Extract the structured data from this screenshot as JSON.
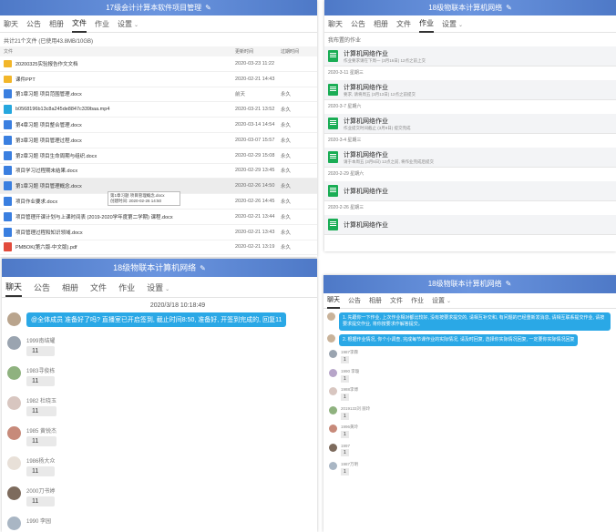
{
  "files_panel": {
    "title": "17级会计计算本软件项目管理",
    "tabs": [
      "聊天",
      "公告",
      "相册",
      "文件",
      "作业",
      "设置"
    ],
    "active_tab": "文件",
    "summary": "共计21个文件 (已使用43.8MB/10GB)",
    "columns": [
      "文件",
      "更新时间",
      "过期时间"
    ],
    "files": [
      {
        "name": "20200325实验报告作文文档",
        "time": "2020-03-23 11:22",
        "expire": "",
        "type": "folder"
      },
      {
        "name": "课件PPT",
        "time": "2020-02-21 14:43",
        "expire": "",
        "type": "folder"
      },
      {
        "name": "第1章习题 项目范围管理.docx",
        "time": "前天",
        "expire": "永久",
        "type": "word"
      },
      {
        "name": "b0568196b13c8a245de8847c339baa.mp4",
        "time": "2020-03-21 13:52",
        "expire": "永久",
        "type": "video"
      },
      {
        "name": "第4章习题 项目整合管理.docx",
        "time": "2020-03-14 14:54",
        "expire": "永久",
        "type": "word"
      },
      {
        "name": "第3章习题 项目管理过程.docx",
        "time": "2020-03-07 15:57",
        "expire": "永久",
        "type": "word"
      },
      {
        "name": "第2章习题 项目生命周期与组织.docx",
        "time": "2020-02-29 15:08",
        "expire": "永久",
        "type": "word"
      },
      {
        "name": "项目学习过程期末结果.docx",
        "time": "2020-02-29 13:45",
        "expire": "永久",
        "type": "word"
      },
      {
        "name": "第1章习题 项目管理概念.docx",
        "time": "2020-02-26 14:50",
        "expire": "永久",
        "type": "word"
      },
      {
        "name": "项目作业要求.docx",
        "time": "2020-02-26 14:45",
        "expire": "永久",
        "type": "word"
      },
      {
        "name": "项目管理开课计划与上课时间表 (2019-2020学年度第二学期) 课程.docx",
        "time": "2020-02-21 13:44",
        "expire": "永久",
        "type": "word"
      },
      {
        "name": "项目管理过程和知识领域.docx",
        "time": "2020-02-21 13:43",
        "expire": "永久",
        "type": "word"
      },
      {
        "name": "PMBOK(第六版-中文版).pdf",
        "time": "2020-02-21 13:19",
        "expire": "永久",
        "type": "pdf"
      }
    ],
    "tooltip": [
      "第1章习题 项目管理概念.docx",
      "创建时间: 2020-02-26 14:50"
    ]
  },
  "homework_panel": {
    "title": "18级物联本计算机网络",
    "tabs": [
      "聊天",
      "公告",
      "相册",
      "文件",
      "作业",
      "设置"
    ],
    "active_tab": "作业",
    "label": "我布置的作业",
    "items": [
      {
        "title": "计算机网络作业",
        "desc": "作业要求请在下周一 (3月16日) 12点之前上交",
        "date": "2020-3-11 星期三"
      },
      {
        "title": "计算机网络作业",
        "desc": "要求, 请将周五 (3月13日) 12点之前提交",
        "date": "2020-3-7 星期六"
      },
      {
        "title": "计算机网络作业",
        "desc": "作业提交时间截止 (3月9日) 提交完成",
        "date": "2020-3-4 星期三"
      },
      {
        "title": "计算机网络作业",
        "desc": "请于本周五 (3月6日) 12点之前, 将作业完成后提交",
        "date": "2020-2-29 星期六"
      },
      {
        "title": "计算机网络作业",
        "desc": "",
        "date": "2020-2-26 星期三"
      },
      {
        "title": "计算机网络作业",
        "desc": "",
        "date": ""
      }
    ]
  },
  "chat_panel_left": {
    "title": "18级物联本计算机网络",
    "tabs": [
      "聊天",
      "公告",
      "相册",
      "文件",
      "作业",
      "设置"
    ],
    "active_tab": "聊天",
    "timestamp": "2020/3/18 10:18:49",
    "announcement": "@全体成员 准备好了吗? 直播室已开启签到, 截止时间8:50, 准备好, 开签到完成的, 回复11",
    "messages": [
      {
        "sender": "1999南结耀",
        "text": "11"
      },
      {
        "sender": "1983寻俊栋",
        "text": "11"
      },
      {
        "sender": "1982 杜晓玉",
        "text": "11"
      },
      {
        "sender": "1985 黄锐杰",
        "text": "11"
      },
      {
        "sender": "1986杨大众",
        "text": "11"
      },
      {
        "sender": "2000刀书婷",
        "text": "11"
      },
      {
        "sender": "1990 李园",
        "text": ""
      }
    ]
  },
  "chat_panel_right": {
    "title": "18级物联本计算机网络",
    "tabs": [
      "聊天",
      "公告",
      "相册",
      "文件",
      "作业",
      "设置"
    ],
    "active_tab": "聊天",
    "notices": [
      "1. 先跟你一下作业, 上次作业相对都比较好, 没有按要求提交的, 请相互补交和, 有问题的已经重新发消息, 请相互联系提交作业, 请按要求提交作业, 将你按要求作解答提交。",
      "2. 根据作业情况, 你个小调查, 完成每节课作业的实际情况, 请及时回复, 选择你实际情况回复, 一定要你实际情况回复"
    ],
    "messages": [
      {
        "sender": "1987李霖",
        "text": "1"
      },
      {
        "sender": "1990 李璇",
        "text": "1"
      },
      {
        "sender": "1988李博",
        "text": "1"
      },
      {
        "sender": "2019133刘 丽玲",
        "text": "1"
      },
      {
        "sender": "1996黄玲",
        "text": "1"
      },
      {
        "sender": "1997",
        "text": "1"
      },
      {
        "sender": "1987万明",
        "text": "1"
      }
    ]
  },
  "colors": {
    "title_bar": "#5b86d6",
    "accent_blue": "#2aa8e6",
    "homework_icon": "#1aad55"
  }
}
